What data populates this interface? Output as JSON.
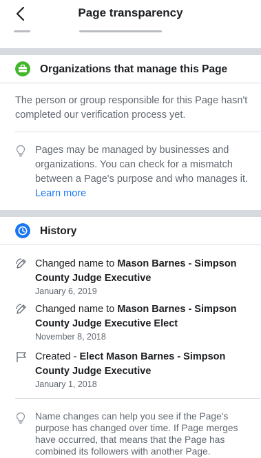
{
  "header": {
    "title": "Page transparency"
  },
  "colors": {
    "organizations_icon": "#42b72a",
    "history_icon": "#1877f2",
    "link": "#1877f2"
  },
  "organizations": {
    "icon": "briefcase-icon",
    "title": "Organizations that manage this Page",
    "description": "The person or group responsible for this Page hasn't completed our verification process yet.",
    "tip_text": "Pages may be managed by businesses and organizations. You can check for a mismatch between a Page's purpose and who manages it. ",
    "tip_link": "Learn more"
  },
  "history": {
    "icon": "clock-icon",
    "title": "History",
    "items": [
      {
        "icon": "pencil-icon",
        "prefix": "Changed name to ",
        "name": "Mason Barnes - Simpson County Judge Executive",
        "date": "January 6, 2019"
      },
      {
        "icon": "pencil-icon",
        "prefix": "Changed name to ",
        "name": "Mason Barnes - Simpson County Judge Executive Elect",
        "date": "November 8, 2018"
      },
      {
        "icon": "flag-icon",
        "prefix": "Created - ",
        "name": "Elect Mason Barnes - Simpson County Judge Executive",
        "date": "January 1, 2018"
      }
    ],
    "tip_text": "Name changes can help you see if the Page's purpose has changed over time. If Page merges have occurred, that means that the Page has combined its followers with another Page."
  }
}
